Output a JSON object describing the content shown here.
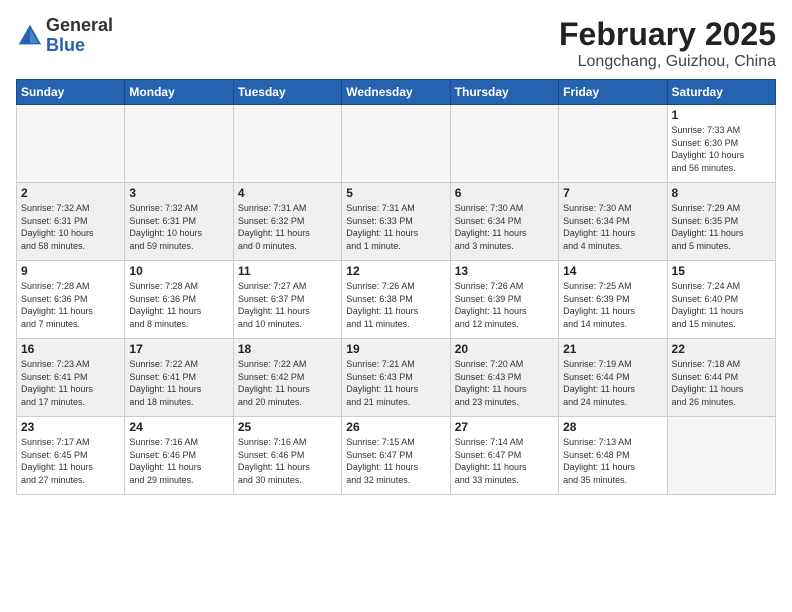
{
  "logo": {
    "general": "General",
    "blue": "Blue"
  },
  "header": {
    "title": "February 2025",
    "subtitle": "Longchang, Guizhou, China"
  },
  "weekdays": [
    "Sunday",
    "Monday",
    "Tuesday",
    "Wednesday",
    "Thursday",
    "Friday",
    "Saturday"
  ],
  "weeks": [
    [
      {
        "day": "",
        "info": ""
      },
      {
        "day": "",
        "info": ""
      },
      {
        "day": "",
        "info": ""
      },
      {
        "day": "",
        "info": ""
      },
      {
        "day": "",
        "info": ""
      },
      {
        "day": "",
        "info": ""
      },
      {
        "day": "1",
        "info": "Sunrise: 7:33 AM\nSunset: 6:30 PM\nDaylight: 10 hours\nand 56 minutes."
      }
    ],
    [
      {
        "day": "2",
        "info": "Sunrise: 7:32 AM\nSunset: 6:31 PM\nDaylight: 10 hours\nand 58 minutes."
      },
      {
        "day": "3",
        "info": "Sunrise: 7:32 AM\nSunset: 6:31 PM\nDaylight: 10 hours\nand 59 minutes."
      },
      {
        "day": "4",
        "info": "Sunrise: 7:31 AM\nSunset: 6:32 PM\nDaylight: 11 hours\nand 0 minutes."
      },
      {
        "day": "5",
        "info": "Sunrise: 7:31 AM\nSunset: 6:33 PM\nDaylight: 11 hours\nand 1 minute."
      },
      {
        "day": "6",
        "info": "Sunrise: 7:30 AM\nSunset: 6:34 PM\nDaylight: 11 hours\nand 3 minutes."
      },
      {
        "day": "7",
        "info": "Sunrise: 7:30 AM\nSunset: 6:34 PM\nDaylight: 11 hours\nand 4 minutes."
      },
      {
        "day": "8",
        "info": "Sunrise: 7:29 AM\nSunset: 6:35 PM\nDaylight: 11 hours\nand 5 minutes."
      }
    ],
    [
      {
        "day": "9",
        "info": "Sunrise: 7:28 AM\nSunset: 6:36 PM\nDaylight: 11 hours\nand 7 minutes."
      },
      {
        "day": "10",
        "info": "Sunrise: 7:28 AM\nSunset: 6:36 PM\nDaylight: 11 hours\nand 8 minutes."
      },
      {
        "day": "11",
        "info": "Sunrise: 7:27 AM\nSunset: 6:37 PM\nDaylight: 11 hours\nand 10 minutes."
      },
      {
        "day": "12",
        "info": "Sunrise: 7:26 AM\nSunset: 6:38 PM\nDaylight: 11 hours\nand 11 minutes."
      },
      {
        "day": "13",
        "info": "Sunrise: 7:26 AM\nSunset: 6:39 PM\nDaylight: 11 hours\nand 12 minutes."
      },
      {
        "day": "14",
        "info": "Sunrise: 7:25 AM\nSunset: 6:39 PM\nDaylight: 11 hours\nand 14 minutes."
      },
      {
        "day": "15",
        "info": "Sunrise: 7:24 AM\nSunset: 6:40 PM\nDaylight: 11 hours\nand 15 minutes."
      }
    ],
    [
      {
        "day": "16",
        "info": "Sunrise: 7:23 AM\nSunset: 6:41 PM\nDaylight: 11 hours\nand 17 minutes."
      },
      {
        "day": "17",
        "info": "Sunrise: 7:22 AM\nSunset: 6:41 PM\nDaylight: 11 hours\nand 18 minutes."
      },
      {
        "day": "18",
        "info": "Sunrise: 7:22 AM\nSunset: 6:42 PM\nDaylight: 11 hours\nand 20 minutes."
      },
      {
        "day": "19",
        "info": "Sunrise: 7:21 AM\nSunset: 6:43 PM\nDaylight: 11 hours\nand 21 minutes."
      },
      {
        "day": "20",
        "info": "Sunrise: 7:20 AM\nSunset: 6:43 PM\nDaylight: 11 hours\nand 23 minutes."
      },
      {
        "day": "21",
        "info": "Sunrise: 7:19 AM\nSunset: 6:44 PM\nDaylight: 11 hours\nand 24 minutes."
      },
      {
        "day": "22",
        "info": "Sunrise: 7:18 AM\nSunset: 6:44 PM\nDaylight: 11 hours\nand 26 minutes."
      }
    ],
    [
      {
        "day": "23",
        "info": "Sunrise: 7:17 AM\nSunset: 6:45 PM\nDaylight: 11 hours\nand 27 minutes."
      },
      {
        "day": "24",
        "info": "Sunrise: 7:16 AM\nSunset: 6:46 PM\nDaylight: 11 hours\nand 29 minutes."
      },
      {
        "day": "25",
        "info": "Sunrise: 7:16 AM\nSunset: 6:46 PM\nDaylight: 11 hours\nand 30 minutes."
      },
      {
        "day": "26",
        "info": "Sunrise: 7:15 AM\nSunset: 6:47 PM\nDaylight: 11 hours\nand 32 minutes."
      },
      {
        "day": "27",
        "info": "Sunrise: 7:14 AM\nSunset: 6:47 PM\nDaylight: 11 hours\nand 33 minutes."
      },
      {
        "day": "28",
        "info": "Sunrise: 7:13 AM\nSunset: 6:48 PM\nDaylight: 11 hours\nand 35 minutes."
      },
      {
        "day": "",
        "info": ""
      }
    ]
  ]
}
